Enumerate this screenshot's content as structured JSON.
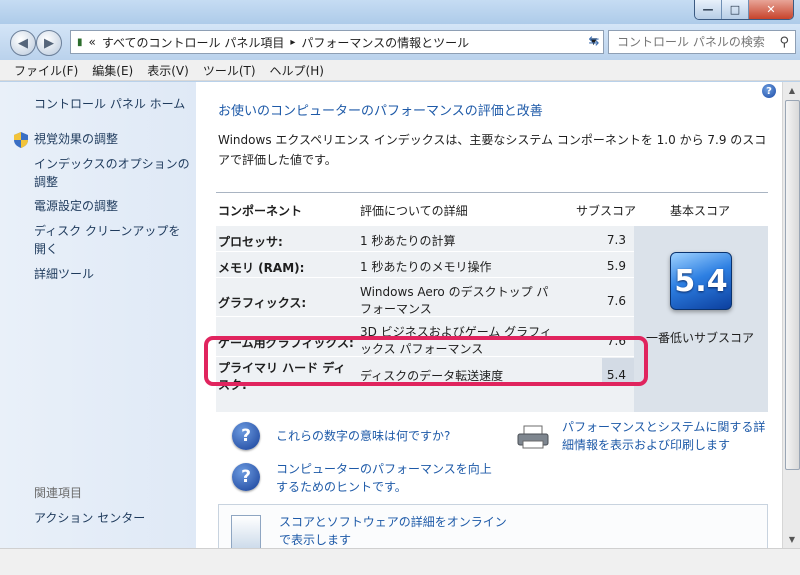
{
  "window": {
    "minimize": "—",
    "maximize": "□",
    "close": "✕"
  },
  "address": {
    "chevrons": "«",
    "crumb1": "すべてのコントロール パネル項目",
    "sep": "▸",
    "crumb2": "パフォーマンスの情報とツール",
    "search_placeholder": "コントロール パネルの検索"
  },
  "menu": [
    "ファイル(F)",
    "編集(E)",
    "表示(V)",
    "ツール(T)",
    "ヘルプ(H)"
  ],
  "sidebar": {
    "home": "コントロール パネル ホーム",
    "links": [
      "視覚効果の調整",
      "インデックスのオプションの調整",
      "電源設定の調整",
      "ディスク クリーンアップを開く",
      "詳細ツール"
    ],
    "related_heading": "関連項目",
    "related": [
      "アクション センター"
    ]
  },
  "main": {
    "title": "お使いのコンピューターのパフォーマンスの評価と改善",
    "intro": "Windows エクスペリエンス インデックスは、主要なシステム コンポーネントを 1.0 から 7.9 のスコアで評価した値です。",
    "headers": {
      "component": "コンポーネント",
      "detail": "評価についての詳細",
      "subscore": "サブスコア",
      "basescore": "基本スコア"
    },
    "rows": [
      {
        "component": "プロセッサ:",
        "detail": "1 秒あたりの計算",
        "score": "7.3"
      },
      {
        "component": "メモリ (RAM):",
        "detail": "1 秒あたりのメモリ操作",
        "score": "5.9"
      },
      {
        "component": "グラフィックス:",
        "detail": "Windows Aero のデスクトップ パフォーマンス",
        "score": "7.6"
      },
      {
        "component": "ゲーム用グラフィックス:",
        "detail": "3D ビジネスおよびゲーム グラフィックス パフォーマンス",
        "score": "7.6"
      },
      {
        "component": "プライマリ ハード ディスク:",
        "detail": "ディスクのデータ転送速度",
        "score": "5.4"
      }
    ],
    "base_score": "5.4",
    "base_caption": "一番低いサブスコア",
    "links": {
      "meaning": "これらの数字の意味は何ですか?",
      "print": "パフォーマンスとシステムに関する詳細情報を表示および印刷します",
      "tips": "コンピューターのパフォーマンスを向上するためのヒントです。",
      "online": "スコアとソフトウェアの詳細をオンラインで表示します"
    }
  },
  "colors": {
    "link": "#1e5aa8",
    "highlight": "#e0245e",
    "badge": "#2d7fe2"
  }
}
